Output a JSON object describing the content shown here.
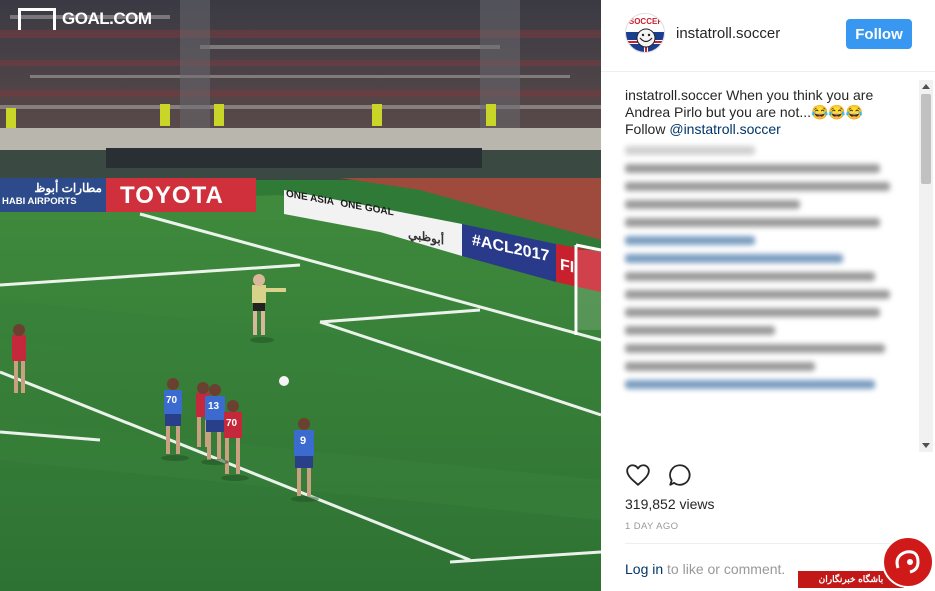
{
  "media": {
    "logo_text": "GOAL.COM",
    "boards": {
      "airports": "مطارات أبوظ",
      "airports_en": "HABI AIRPORTS",
      "toyota": "TOYOTA",
      "one_asia": "ONE ASIA",
      "one_goal": "ONE GOAL",
      "abudhabi": "أبوظبي",
      "acl": "#ACL2017",
      "fi": "FI"
    },
    "jerseys": [
      "70",
      "13",
      "70",
      "9"
    ]
  },
  "header": {
    "username": "instatroll.soccer",
    "avatar_text": "SOCCER",
    "follow_label": "Follow"
  },
  "caption": {
    "username": "instatroll.soccer",
    "text": " When you think you are Andrea Pirlo but you are not...😂😂😂",
    "follow_prefix": "Follow ",
    "mention": "@instatroll.soccer"
  },
  "stats": {
    "views": "319,852 views",
    "date": "1 DAY AGO"
  },
  "footer": {
    "login_link": "Log in",
    "login_suffix": " to like or comment."
  },
  "watermark": {
    "text": "باشگاه خبرنگاران"
  },
  "colors": {
    "follow_bg": "#3897f0",
    "link": "#003569",
    "pitch": "#2f7a36",
    "watermark_red": "#c21818"
  },
  "icons": [
    "heart-icon",
    "comment-icon",
    "scroll-up-icon",
    "scroll-down-icon",
    "goal-logo-icon"
  ]
}
